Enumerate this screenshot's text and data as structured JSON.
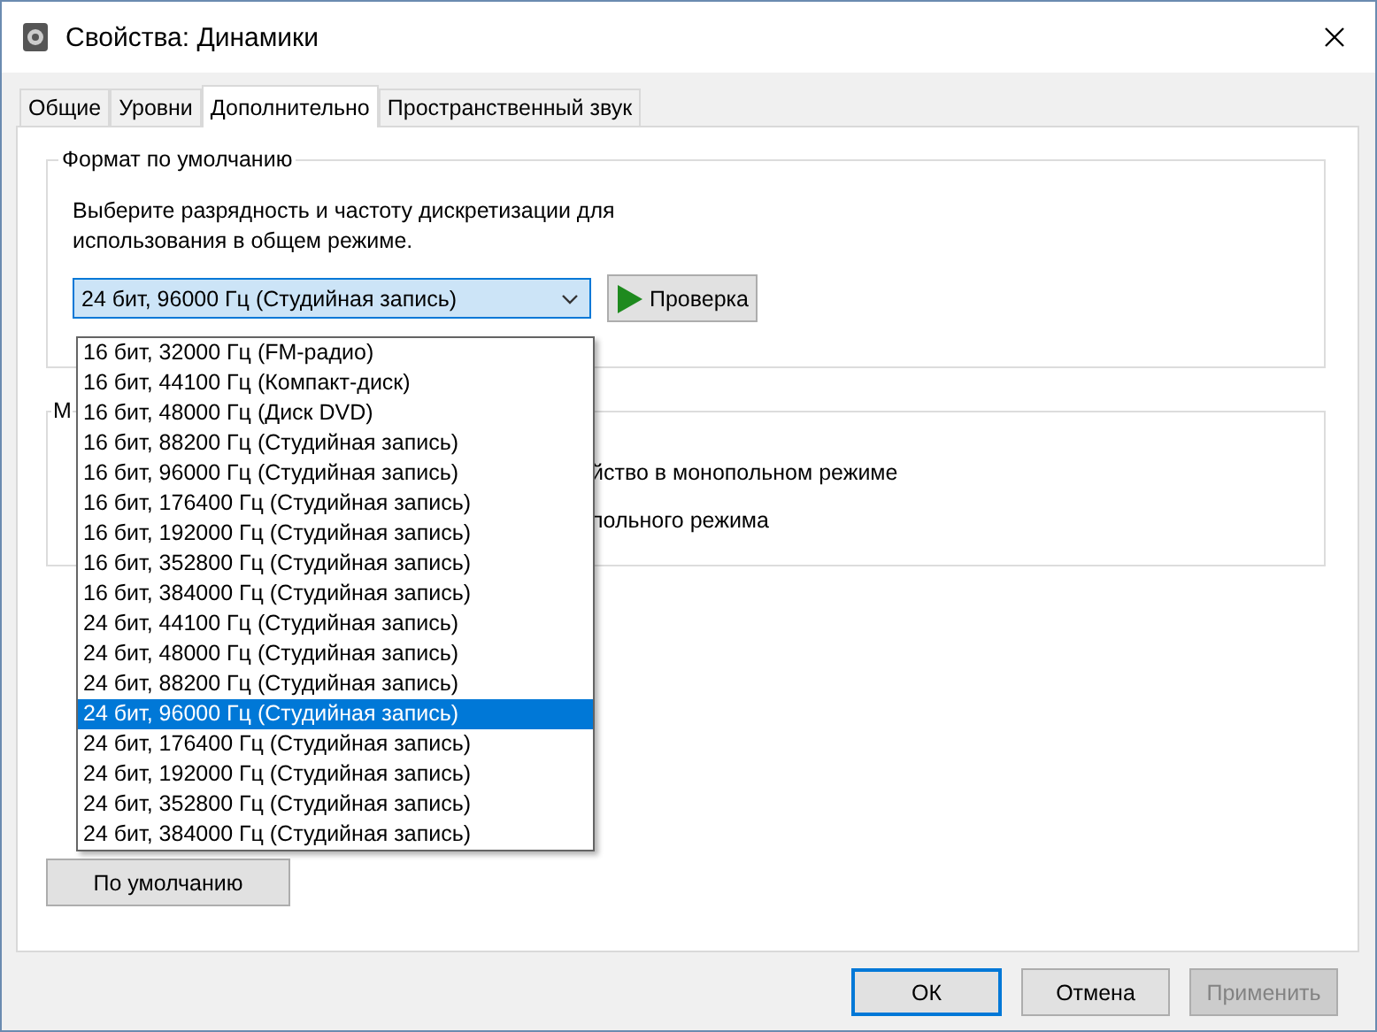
{
  "window": {
    "title": "Свойства: Динамики"
  },
  "tabs": [
    {
      "label": "Общие",
      "selected": false
    },
    {
      "label": "Уровни",
      "selected": false
    },
    {
      "label": "Дополнительно",
      "selected": true
    },
    {
      "label": "Пространственный звук",
      "selected": false
    }
  ],
  "default_format": {
    "title": "Формат по умолчанию",
    "description": "Выберите разрядность и частоту дискретизации для использования в общем режиме.",
    "value": "24 бит, 96000 Гц (Студийная запись)",
    "test_button": "Проверка",
    "options": [
      {
        "label": "16 бит, 32000 Гц (FM-радио)",
        "selected": false
      },
      {
        "label": "16 бит, 44100 Гц (Компакт-диск)",
        "selected": false
      },
      {
        "label": "16 бит, 48000 Гц (Диск DVD)",
        "selected": false
      },
      {
        "label": "16 бит, 88200 Гц (Студийная запись)",
        "selected": false
      },
      {
        "label": "16 бит, 96000 Гц (Студийная запись)",
        "selected": false
      },
      {
        "label": "16 бит, 176400 Гц (Студийная запись)",
        "selected": false
      },
      {
        "label": "16 бит, 192000 Гц (Студийная запись)",
        "selected": false
      },
      {
        "label": "16 бит, 352800 Гц (Студийная запись)",
        "selected": false
      },
      {
        "label": "16 бит, 384000 Гц (Студийная запись)",
        "selected": false
      },
      {
        "label": "24 бит, 44100 Гц (Студийная запись)",
        "selected": false
      },
      {
        "label": "24 бит, 48000 Гц (Студийная запись)",
        "selected": false
      },
      {
        "label": "24 бит, 88200 Гц (Студийная запись)",
        "selected": false
      },
      {
        "label": "24 бит, 96000 Гц (Студийная запись)",
        "selected": true
      },
      {
        "label": "24 бит, 176400 Гц (Студийная запись)",
        "selected": false
      },
      {
        "label": "24 бит, 192000 Гц (Студийная запись)",
        "selected": false
      },
      {
        "label": "24 бит, 352800 Гц (Студийная запись)",
        "selected": false
      },
      {
        "label": "24 бит, 384000 Гц (Студийная запись)",
        "selected": false
      }
    ]
  },
  "exclusive_mode": {
    "title": "М",
    "lines": [
      "йство в монопольном режиме",
      "польного режима"
    ]
  },
  "restore_button": "По умолчанию",
  "buttons": [
    {
      "label": "ОК",
      "kind": "default",
      "disabled": false
    },
    {
      "label": "Отмена",
      "kind": "normal",
      "disabled": false
    },
    {
      "label": "Применить",
      "kind": "normal",
      "disabled": true
    }
  ]
}
